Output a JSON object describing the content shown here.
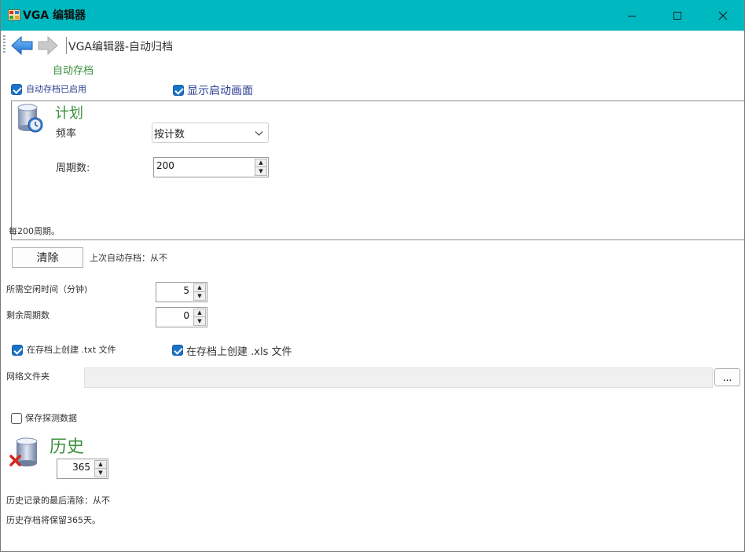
{
  "window": {
    "title": "VGA 编辑器",
    "accent_color": "#00b8c0"
  },
  "nav": {
    "path": "VGA编辑器-自动归档"
  },
  "autosave": {
    "section_title": "自动存档",
    "enabled_label": "自动存档已启用",
    "enabled": true,
    "show_splash_label": "显示启动画面",
    "show_splash": true
  },
  "schedule": {
    "title": "计划",
    "frequency_label": "频率",
    "frequency_value": "按计数",
    "cycles_label": "周期数:",
    "cycles_value": "200",
    "summary": "每200周期。"
  },
  "actions": {
    "clear_label": "清除",
    "last_autosave": "上次自动存档：从不"
  },
  "idle": {
    "label": "所需空闲时间（分钟)",
    "value": "5"
  },
  "remaining": {
    "label": "剩余周期数",
    "value": "0"
  },
  "create_txt": {
    "label": "在存档上创建 .txt 文件",
    "checked": true
  },
  "create_xls": {
    "label": "在存档上创建 .xls 文件",
    "checked": true
  },
  "network": {
    "label": "网络文件夹",
    "value": "",
    "browse_label": "..."
  },
  "save_probe": {
    "label": "保存探测数据",
    "checked": false
  },
  "history": {
    "title": "历史",
    "days_value": "365",
    "last_clear": "历史记录的最后清除：从不",
    "retention": "历史存档将保留365天。"
  }
}
